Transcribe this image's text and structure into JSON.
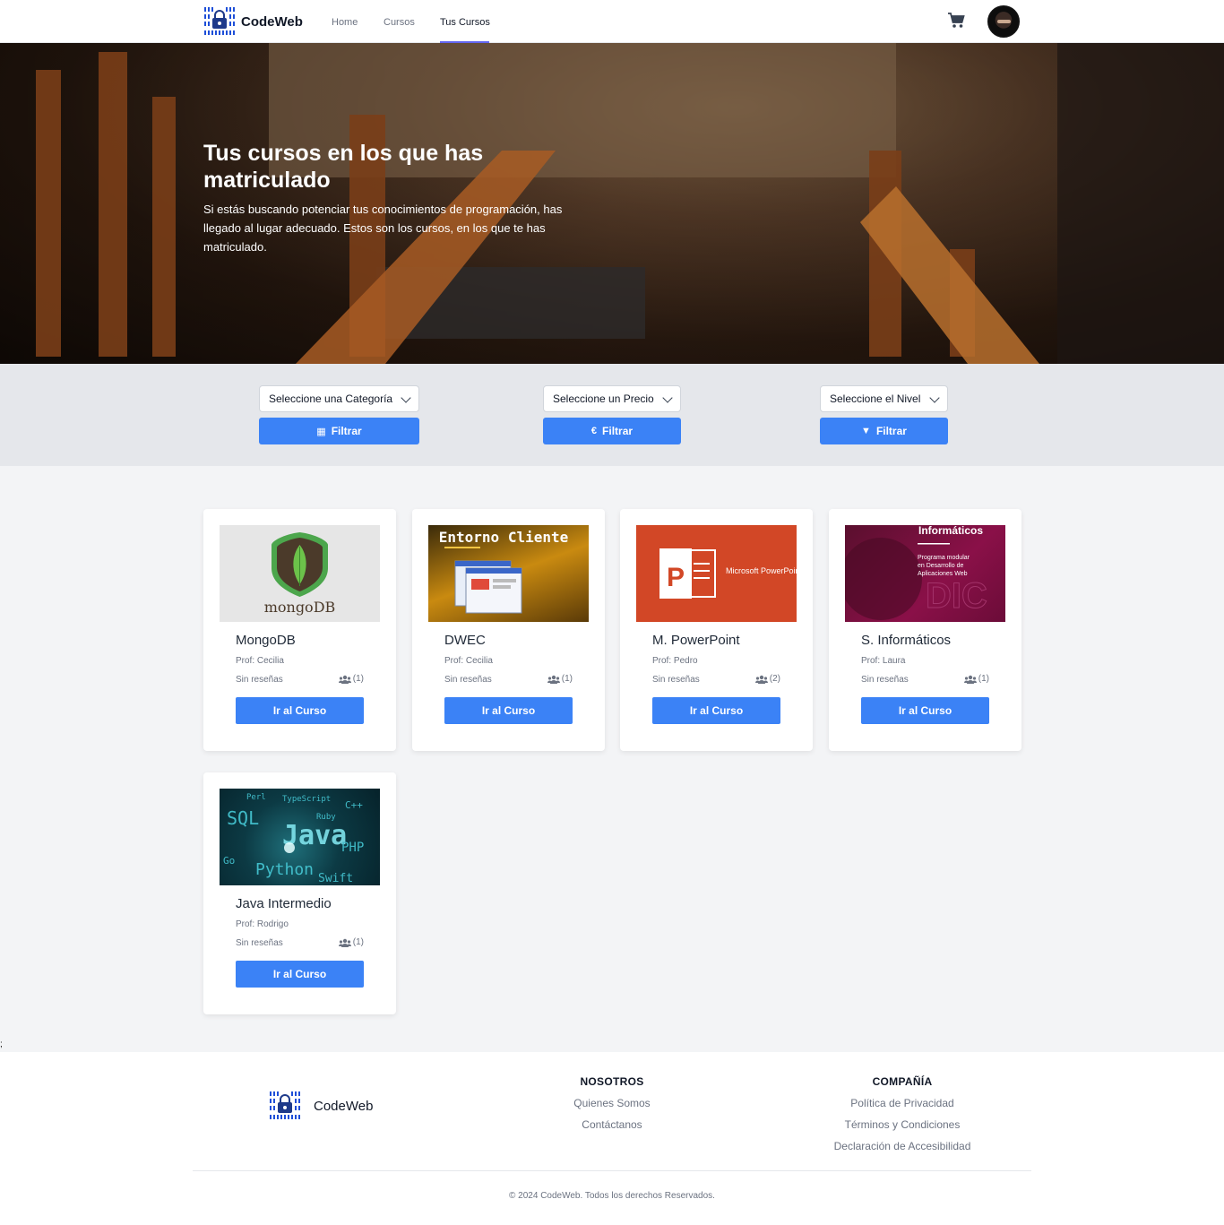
{
  "brand": {
    "name": "CodeWeb"
  },
  "nav": {
    "links": [
      "Home",
      "Cursos",
      "Tus Cursos"
    ],
    "active": "Tus Cursos"
  },
  "hero": {
    "title": "Tus cursos en los que has matriculado",
    "text": "Si estás buscando potenciar tus conocimientos de programación, has llegado al lugar adecuado. Estos son los cursos, en los que te has matriculado."
  },
  "filters": {
    "category": {
      "placeholder": "Seleccione una Categoría",
      "button": "Filtrar",
      "icon": "grid-icon"
    },
    "price": {
      "placeholder": "Seleccione un Precio",
      "button": "Filtrar",
      "icon": "euro-icon"
    },
    "level": {
      "placeholder": "Seleccione el Nivel",
      "button": "Filtrar",
      "icon": "filter-icon"
    }
  },
  "courses": [
    {
      "title": "MongoDB",
      "prof": "Prof: Cecilia",
      "reviews": "Sin reseñas",
      "students": "(1)",
      "button": "Ir al Curso",
      "thumb_text": "mongoDB"
    },
    {
      "title": "DWEC",
      "prof": "Prof: Cecilia",
      "reviews": "Sin reseñas",
      "students": "(1)",
      "button": "Ir al Curso",
      "thumb_text": "Entorno Cliente"
    },
    {
      "title": "M. PowerPoint",
      "prof": "Prof: Pedro",
      "reviews": "Sin reseñas",
      "students": "(2)",
      "button": "Ir al Curso",
      "thumb_text": "Microsoft PowerPoint"
    },
    {
      "title": "S. Informáticos",
      "prof": "Prof: Laura",
      "reviews": "Sin reseñas",
      "students": "(1)",
      "button": "Ir al Curso",
      "thumb_text": "Informáticos",
      "thumb_sub": "Programa modular en Desarrollo de Aplicaciones Web"
    },
    {
      "title": "Java Intermedio",
      "prof": "Prof: Rodrigo",
      "reviews": "Sin reseñas",
      "students": "(1)",
      "button": "Ir al Curso",
      "thumb_words": [
        "SQL",
        "Java",
        "Python",
        "PHP",
        "Ruby",
        "Perl",
        "TypeScript",
        "C++",
        "Go",
        "Swift"
      ]
    }
  ],
  "stray_text": ";",
  "footer": {
    "brand": "CodeWeb",
    "nosotros": {
      "title": "NOSOTROS",
      "links": [
        "Quienes Somos",
        "Contáctanos"
      ]
    },
    "compania": {
      "title": "COMPAÑÍA",
      "links": [
        "Política de Privacidad",
        "Términos y Condiciones",
        "Declaración de Accesibilidad"
      ]
    },
    "copyright": "© 2024 CodeWeb. Todos los derechos Reservados."
  },
  "colors": {
    "primary": "#3b82f6",
    "nav_indicator": "#6366f1",
    "page_bg": "#f3f4f6"
  }
}
